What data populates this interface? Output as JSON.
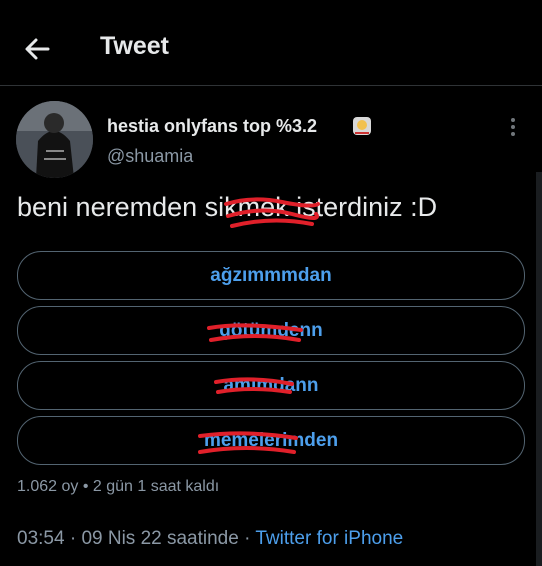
{
  "header": {
    "title": "Tweet",
    "back_icon": "arrow-left-icon"
  },
  "tweet": {
    "display_name": "hestia onlyfans top %3.2",
    "handle": "@shuamia",
    "text": "beni neremden sikmek isterdiniz :D",
    "more_icon": "more-vertical-icon"
  },
  "poll": {
    "options": [
      "ağzımmmdan",
      "götümdenn",
      "amımdann",
      "memelerimden"
    ],
    "meta": "1.062 oy • 2 gün 1 saat kaldı"
  },
  "footer": {
    "time": "03:54",
    "date": "09 Nis 22 saatinde",
    "separator": "·",
    "source": "Twitter for iPhone"
  },
  "colors": {
    "accent": "#4d9fec",
    "muted": "#8b98a5",
    "scribble": "#e0202a",
    "background": "#000000"
  }
}
